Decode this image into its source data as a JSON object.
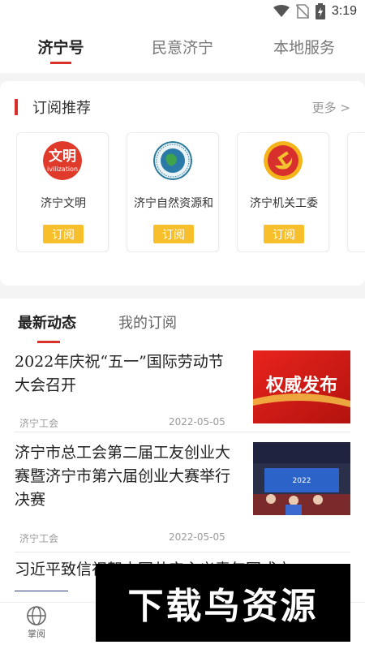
{
  "status_bar": {
    "time": "3:19",
    "icons": [
      "wifi-icon",
      "no-sim-icon",
      "battery-charging-icon"
    ]
  },
  "top_tabs": [
    {
      "label": "济宁号",
      "active": true
    },
    {
      "label": "民意济宁",
      "active": false
    },
    {
      "label": "本地服务",
      "active": false
    }
  ],
  "subscribe_section": {
    "title": "订阅推荐",
    "more": "更多 >",
    "accounts": [
      {
        "name": "济宁文明",
        "button": "订阅",
        "logo_text": "文明",
        "logo_sub": "ivilization"
      },
      {
        "name": "济宁自然资源和",
        "button": "订阅"
      },
      {
        "name": "济宁机关工委",
        "button": "订阅"
      }
    ]
  },
  "feed_tabs": [
    {
      "label": "最新动态",
      "active": true
    },
    {
      "label": "我的订阅",
      "active": false
    }
  ],
  "news": [
    {
      "title": "2022年庆祝“五一”国际劳动节大会召开",
      "source": "济宁工会",
      "date": "2022-05-05",
      "thumb_text": "权威发布"
    },
    {
      "title": "济宁市总工会第二届工友创业大赛暨济宁市第六届创业大赛举行决赛",
      "source": "济宁工会",
      "date": "2022-05-05",
      "thumb_text": "2022"
    },
    {
      "title": "习近平致信祝贺中国共产主义青年团成立",
      "source": "",
      "date": ""
    }
  ],
  "bottom_nav": {
    "items": [
      {
        "label": "掌阅",
        "icon": "globe-icon"
      }
    ]
  },
  "watermark": "下载鸟资源",
  "colors": {
    "accent": "#d8302c",
    "subscribe_button": "#f7bf2c"
  }
}
